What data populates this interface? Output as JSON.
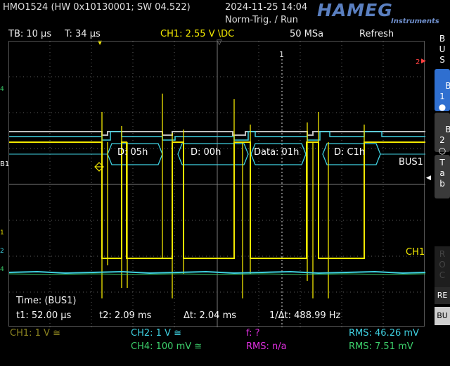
{
  "header": {
    "device": "HMO1524 (HW 0x10130001; SW 04.522)",
    "datetime": "2024-11-25 14:04",
    "trigger_mode": "Norm-Trig. / Run",
    "brand": "HAMEG",
    "brand_sub": "Instruments"
  },
  "status": {
    "timebase": "TB: 10 µs",
    "trigger_time": "T: 34 µs",
    "ch1_trigger": "CH1: 2.55 V \\DC",
    "sample_rate": "50 MSa",
    "acq_mode": "Refresh"
  },
  "side_panel": {
    "bus": "B\nU\nS",
    "b1": "B\n1",
    "b2": "B\n2",
    "tab": "T\na\nb",
    "roc": "R\nO\nC",
    "re": "RE",
    "bu": "BU"
  },
  "markers": {
    "cursor1": "1",
    "cursor2": "2",
    "ch_left_b1": "B1",
    "bus1_label": "BUS1",
    "ch1_label": "CH1"
  },
  "decode": {
    "frames": [
      "D: 05h",
      "D: 00h",
      "Data: 01h",
      "D: C1h"
    ]
  },
  "measurement": {
    "title": "Time: (BUS1)",
    "t1": "t1: 52.00 µs",
    "t2": "t2: 2.09 ms",
    "dt": "Δt: 2.04 ms",
    "inv_dt": "1/Δt: 488.99 Hz"
  },
  "bottom": {
    "ch1": "CH1: 1 V ≅",
    "ch2": "CH2: 1 V ≅",
    "ch4": "CH4: 100 mV ≅",
    "freq": "f: ?",
    "rms_main": "RMS: n/a",
    "rms_ch2": "RMS: 46.26 mV",
    "rms_ch4": "RMS: 7.51 mV"
  },
  "colors": {
    "ch1": "#f2e800",
    "ch2": "#3fd0e0",
    "ch4": "#3ccf6b",
    "math": "#e02fe0",
    "accent": "#2f6fd0",
    "grid": "#6a6a6a"
  }
}
